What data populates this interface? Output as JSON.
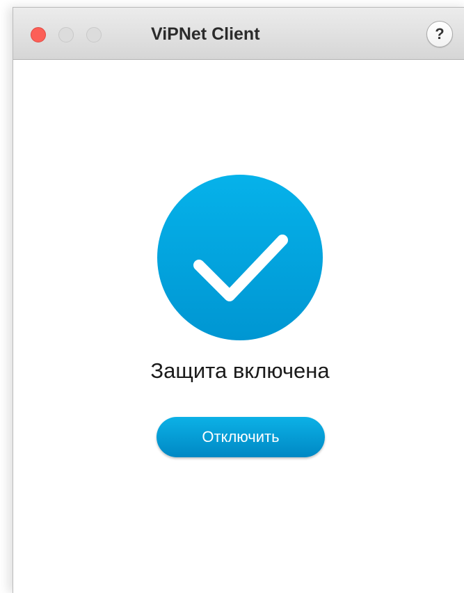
{
  "window": {
    "title": "ViPNet Client",
    "help_label": "?"
  },
  "status": {
    "text": "Защита включена",
    "icon": "checkmark-icon",
    "color": "#06a8e2"
  },
  "actions": {
    "disable_label": "Отключить"
  }
}
